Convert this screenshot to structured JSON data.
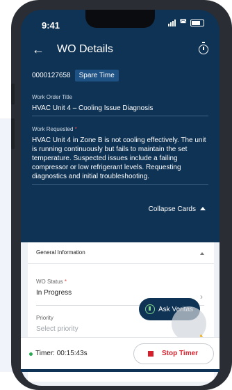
{
  "status_bar": {
    "time": "9:41"
  },
  "header": {
    "title": "WO Details"
  },
  "work_order": {
    "number": "0000127658",
    "badge": "Spare Time"
  },
  "title_field": {
    "label": "Work Order Title",
    "value": "HVAC Unit 4 – Cooling Issue Diagnosis"
  },
  "request_field": {
    "label": "Work Requested",
    "required_mark": "*",
    "value": "HVAC Unit 4 in Zone B is not cooling effectively. The unit is running continuously but fails to maintain the set temperature. Suspected issues include a failing compressor or low refrigerant levels. Requesting diagnostics and initial troubleshooting."
  },
  "collapse": {
    "label": "Collapse Cards"
  },
  "general_card": {
    "title": "General Information",
    "status": {
      "label": "WO Status",
      "required_mark": "*",
      "value": "In Progress"
    },
    "priority": {
      "label": "Priority",
      "placeholder": "Select priority"
    }
  },
  "ask_button": {
    "label": "Ask Veritas"
  },
  "timer": {
    "label": "Timer: 00:15:43s",
    "stop_label": "Stop Timer"
  },
  "colors": {
    "navy": "#0f3354",
    "stop_red": "#d71f2b",
    "timer_green": "#2aa852"
  }
}
